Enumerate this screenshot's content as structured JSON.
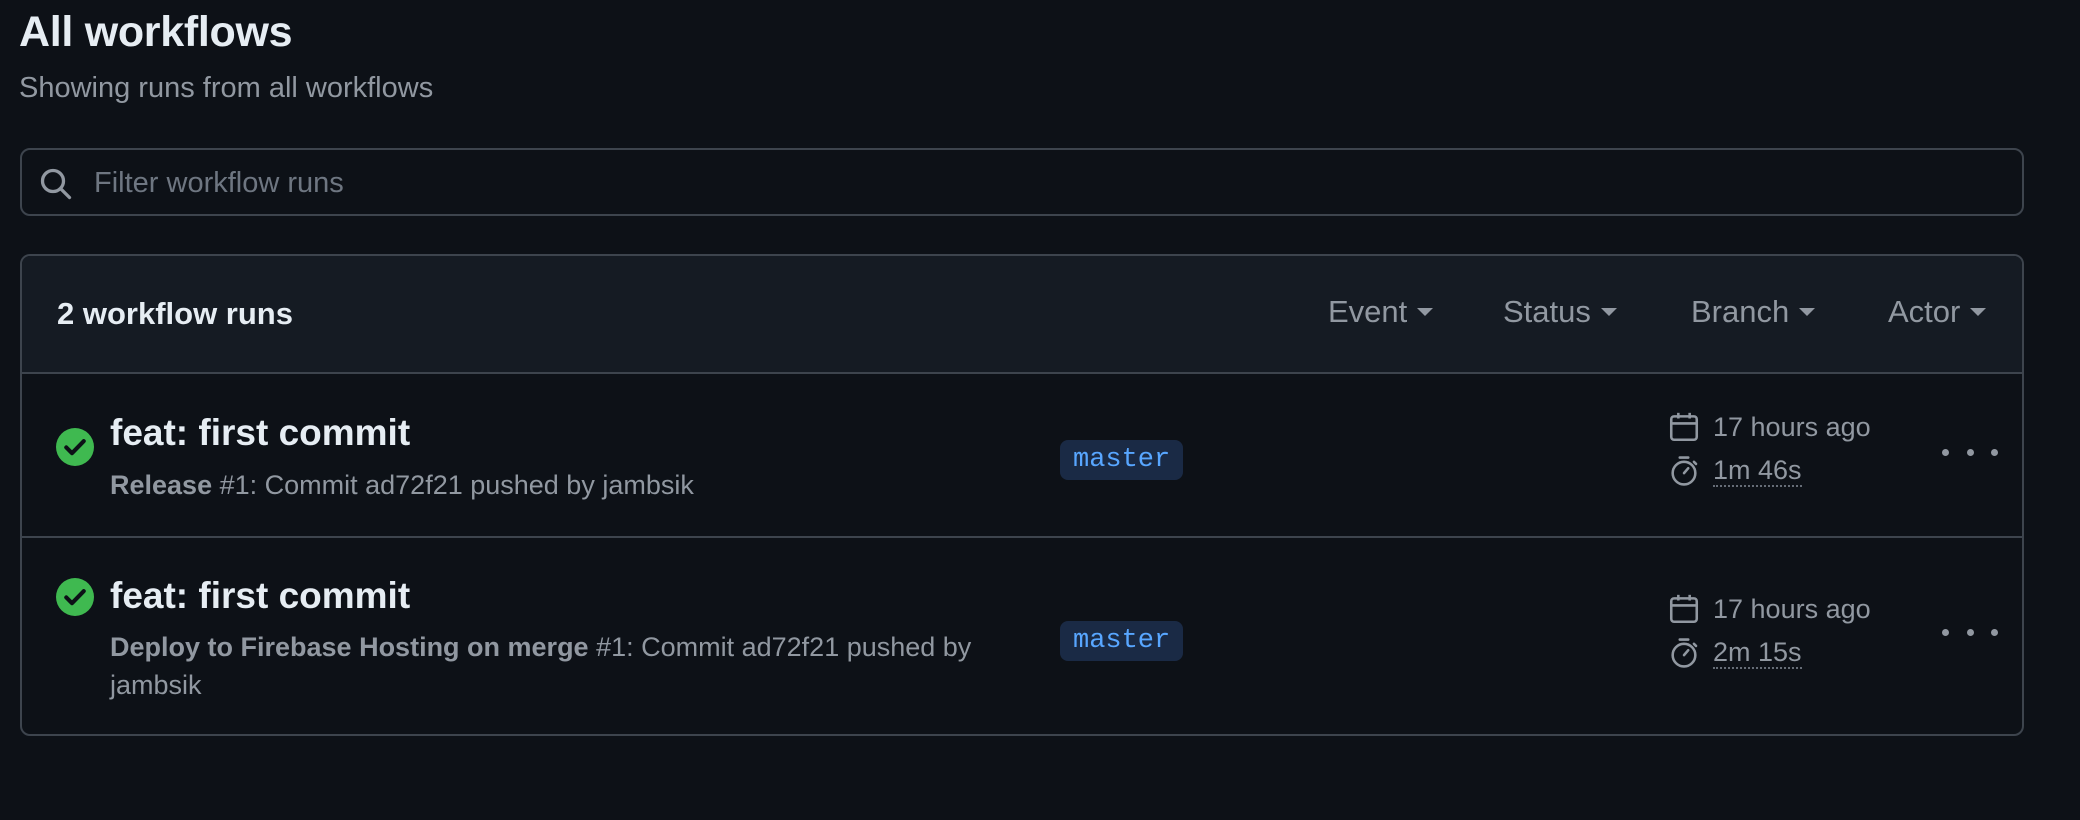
{
  "header": {
    "title": "All workflows",
    "subtitle": "Showing runs from all workflows"
  },
  "search": {
    "placeholder": "Filter workflow runs",
    "value": ""
  },
  "runs_list": {
    "count_label": "2 workflow runs",
    "filters": [
      "Event",
      "Status",
      "Branch",
      "Actor"
    ],
    "runs": [
      {
        "status": "success",
        "title": "feat: first commit",
        "workflow": "Release",
        "meta": " #1: Commit ad72f21 pushed by jambsik",
        "branch": "master",
        "time": "17 hours ago",
        "duration": "1m 46s"
      },
      {
        "status": "success",
        "title": "feat: first commit",
        "workflow": "Deploy to Firebase Hosting on merge",
        "meta": " #1: Commit ad72f21 pushed by jambsik",
        "branch": "master",
        "time": "17 hours ago",
        "duration": "2m 15s"
      }
    ]
  },
  "icons": {
    "search": "search-icon",
    "success": "check-circle-icon",
    "calendar": "calendar-icon",
    "stopwatch": "stopwatch-icon",
    "more": "kebab-horizontal-icon"
  },
  "colors": {
    "background": "#0d1117",
    "header_bg": "#151b23",
    "border": "#3d444d",
    "success": "#3fb950",
    "branch_bg": "#1a2a45",
    "branch_text": "#58a6ff",
    "muted_text": "#9198a1"
  }
}
